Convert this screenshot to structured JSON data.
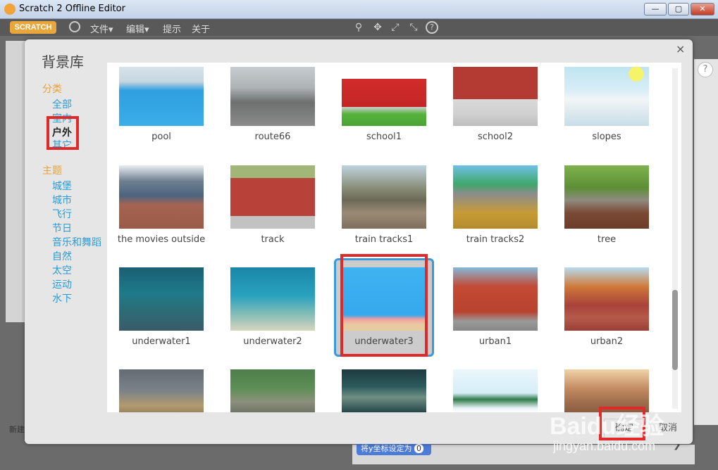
{
  "window": {
    "title": "Scratch 2 Offline Editor",
    "minimize": "—",
    "maximize": "▢",
    "close": "✕"
  },
  "menubar": {
    "logo": "SCRATCH",
    "items": [
      "文件▾",
      "编辑▾",
      "提示",
      "关于"
    ],
    "tools": [
      "⚲",
      "✥",
      "⤢",
      "⤡",
      "?"
    ]
  },
  "dialog": {
    "title": "背景库",
    "close": "×",
    "sidebar": {
      "category_head": "分类",
      "categories": [
        "全部",
        "室内",
        "户外",
        "其它"
      ],
      "theme_head": "主题",
      "themes": [
        "城堡",
        "城市",
        "飞行",
        "节日",
        "音乐和舞蹈",
        "自然",
        "太空",
        "运动",
        "水下"
      ]
    },
    "tiles": [
      {
        "label": "pool"
      },
      {
        "label": "route66"
      },
      {
        "label": "school1"
      },
      {
        "label": "school2"
      },
      {
        "label": "slopes"
      },
      {
        "label": "the movies outside"
      },
      {
        "label": "track"
      },
      {
        "label": "train tracks1"
      },
      {
        "label": "train tracks2"
      },
      {
        "label": "tree"
      },
      {
        "label": "underwater1"
      },
      {
        "label": "underwater2"
      },
      {
        "label": "underwater3"
      },
      {
        "label": "urban1"
      },
      {
        "label": "urban2"
      }
    ],
    "ok": "确定",
    "cancel": "取消"
  },
  "background": {
    "help": "?",
    "new_backdrop": "新建",
    "block_text": "将y坐标设定为",
    "block_value": "0"
  },
  "watermark": {
    "main": "Baidu经验",
    "url": "jingyan.baidu.com"
  }
}
